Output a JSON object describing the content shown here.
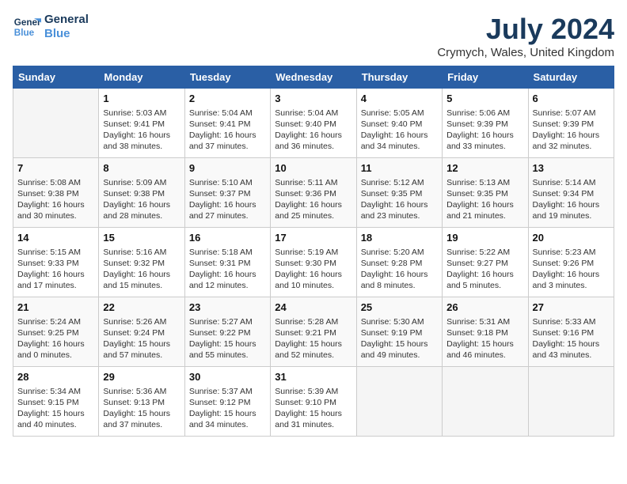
{
  "header": {
    "logo_line1": "General",
    "logo_line2": "Blue",
    "month_year": "July 2024",
    "location": "Crymych, Wales, United Kingdom"
  },
  "weekdays": [
    "Sunday",
    "Monday",
    "Tuesday",
    "Wednesday",
    "Thursday",
    "Friday",
    "Saturday"
  ],
  "weeks": [
    [
      {
        "day": "",
        "info": ""
      },
      {
        "day": "1",
        "info": "Sunrise: 5:03 AM\nSunset: 9:41 PM\nDaylight: 16 hours\nand 38 minutes."
      },
      {
        "day": "2",
        "info": "Sunrise: 5:04 AM\nSunset: 9:41 PM\nDaylight: 16 hours\nand 37 minutes."
      },
      {
        "day": "3",
        "info": "Sunrise: 5:04 AM\nSunset: 9:40 PM\nDaylight: 16 hours\nand 36 minutes."
      },
      {
        "day": "4",
        "info": "Sunrise: 5:05 AM\nSunset: 9:40 PM\nDaylight: 16 hours\nand 34 minutes."
      },
      {
        "day": "5",
        "info": "Sunrise: 5:06 AM\nSunset: 9:39 PM\nDaylight: 16 hours\nand 33 minutes."
      },
      {
        "day": "6",
        "info": "Sunrise: 5:07 AM\nSunset: 9:39 PM\nDaylight: 16 hours\nand 32 minutes."
      }
    ],
    [
      {
        "day": "7",
        "info": "Sunrise: 5:08 AM\nSunset: 9:38 PM\nDaylight: 16 hours\nand 30 minutes."
      },
      {
        "day": "8",
        "info": "Sunrise: 5:09 AM\nSunset: 9:38 PM\nDaylight: 16 hours\nand 28 minutes."
      },
      {
        "day": "9",
        "info": "Sunrise: 5:10 AM\nSunset: 9:37 PM\nDaylight: 16 hours\nand 27 minutes."
      },
      {
        "day": "10",
        "info": "Sunrise: 5:11 AM\nSunset: 9:36 PM\nDaylight: 16 hours\nand 25 minutes."
      },
      {
        "day": "11",
        "info": "Sunrise: 5:12 AM\nSunset: 9:35 PM\nDaylight: 16 hours\nand 23 minutes."
      },
      {
        "day": "12",
        "info": "Sunrise: 5:13 AM\nSunset: 9:35 PM\nDaylight: 16 hours\nand 21 minutes."
      },
      {
        "day": "13",
        "info": "Sunrise: 5:14 AM\nSunset: 9:34 PM\nDaylight: 16 hours\nand 19 minutes."
      }
    ],
    [
      {
        "day": "14",
        "info": "Sunrise: 5:15 AM\nSunset: 9:33 PM\nDaylight: 16 hours\nand 17 minutes."
      },
      {
        "day": "15",
        "info": "Sunrise: 5:16 AM\nSunset: 9:32 PM\nDaylight: 16 hours\nand 15 minutes."
      },
      {
        "day": "16",
        "info": "Sunrise: 5:18 AM\nSunset: 9:31 PM\nDaylight: 16 hours\nand 12 minutes."
      },
      {
        "day": "17",
        "info": "Sunrise: 5:19 AM\nSunset: 9:30 PM\nDaylight: 16 hours\nand 10 minutes."
      },
      {
        "day": "18",
        "info": "Sunrise: 5:20 AM\nSunset: 9:28 PM\nDaylight: 16 hours\nand 8 minutes."
      },
      {
        "day": "19",
        "info": "Sunrise: 5:22 AM\nSunset: 9:27 PM\nDaylight: 16 hours\nand 5 minutes."
      },
      {
        "day": "20",
        "info": "Sunrise: 5:23 AM\nSunset: 9:26 PM\nDaylight: 16 hours\nand 3 minutes."
      }
    ],
    [
      {
        "day": "21",
        "info": "Sunrise: 5:24 AM\nSunset: 9:25 PM\nDaylight: 16 hours\nand 0 minutes."
      },
      {
        "day": "22",
        "info": "Sunrise: 5:26 AM\nSunset: 9:24 PM\nDaylight: 15 hours\nand 57 minutes."
      },
      {
        "day": "23",
        "info": "Sunrise: 5:27 AM\nSunset: 9:22 PM\nDaylight: 15 hours\nand 55 minutes."
      },
      {
        "day": "24",
        "info": "Sunrise: 5:28 AM\nSunset: 9:21 PM\nDaylight: 15 hours\nand 52 minutes."
      },
      {
        "day": "25",
        "info": "Sunrise: 5:30 AM\nSunset: 9:19 PM\nDaylight: 15 hours\nand 49 minutes."
      },
      {
        "day": "26",
        "info": "Sunrise: 5:31 AM\nSunset: 9:18 PM\nDaylight: 15 hours\nand 46 minutes."
      },
      {
        "day": "27",
        "info": "Sunrise: 5:33 AM\nSunset: 9:16 PM\nDaylight: 15 hours\nand 43 minutes."
      }
    ],
    [
      {
        "day": "28",
        "info": "Sunrise: 5:34 AM\nSunset: 9:15 PM\nDaylight: 15 hours\nand 40 minutes."
      },
      {
        "day": "29",
        "info": "Sunrise: 5:36 AM\nSunset: 9:13 PM\nDaylight: 15 hours\nand 37 minutes."
      },
      {
        "day": "30",
        "info": "Sunrise: 5:37 AM\nSunset: 9:12 PM\nDaylight: 15 hours\nand 34 minutes."
      },
      {
        "day": "31",
        "info": "Sunrise: 5:39 AM\nSunset: 9:10 PM\nDaylight: 15 hours\nand 31 minutes."
      },
      {
        "day": "",
        "info": ""
      },
      {
        "day": "",
        "info": ""
      },
      {
        "day": "",
        "info": ""
      }
    ]
  ]
}
